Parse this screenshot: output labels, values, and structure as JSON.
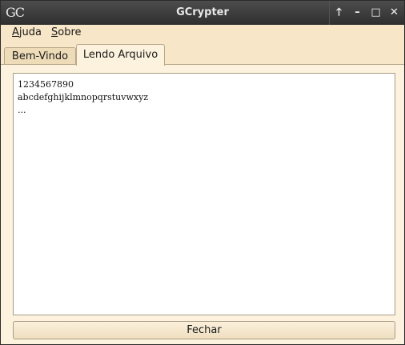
{
  "window": {
    "title": "GCrypter",
    "icon_text": "GC",
    "controls": [
      {
        "name": "raise-icon",
        "glyph": "🡑"
      },
      {
        "name": "minimize-icon",
        "glyph": "–"
      },
      {
        "name": "maximize-icon",
        "glyph": "□"
      },
      {
        "name": "close-icon",
        "glyph": "✕"
      }
    ]
  },
  "menubar": {
    "items": [
      {
        "mnemonic": "A",
        "rest": "juda"
      },
      {
        "mnemonic": "S",
        "rest": "obre"
      }
    ]
  },
  "tabs": [
    {
      "label": "Bem-Vindo",
      "active": false
    },
    {
      "label": "Lendo Arquivo",
      "active": true
    }
  ],
  "content": {
    "lines": [
      "1234567890",
      "abcdefghijklmnopqrstuvwxyz",
      "..."
    ]
  },
  "footer": {
    "close_label": "Fechar"
  },
  "colors": {
    "background": "#f7e6c7",
    "titlebar": "#3a3a3a",
    "textarea_bg": "#ffffff"
  }
}
